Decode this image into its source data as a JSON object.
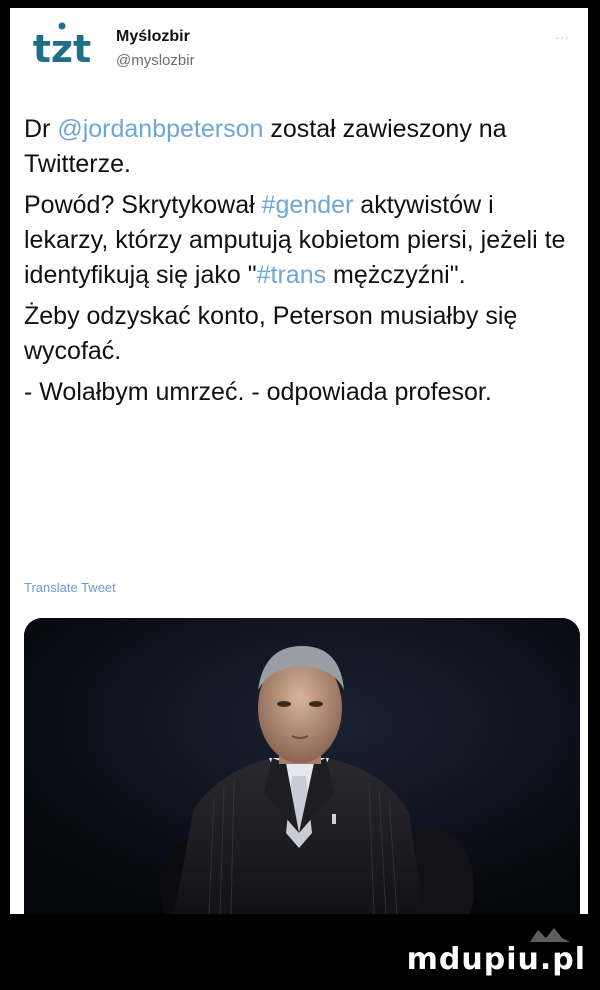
{
  "account": {
    "name": "Myślozbir",
    "handle": "@myslozbir",
    "logo_text": "tzt",
    "logo_color": "#1f6f86"
  },
  "more_menu": "...",
  "tweet": {
    "paragraphs": [
      [
        {
          "text": "Dr ",
          "link": false
        },
        {
          "text": "@jordanbpeterson",
          "link": true
        },
        {
          "text": " został zawieszony na Twitterze.",
          "link": false
        }
      ],
      [
        {
          "text": "Powód? Skrytykował ",
          "link": false
        },
        {
          "text": "#gender",
          "link": true
        },
        {
          "text": " aktywistów i lekarzy, którzy amputują kobietom piersi, jeżeli te identyfikują się jako \"",
          "link": false
        },
        {
          "text": "#trans",
          "link": true
        },
        {
          "text": " mężczyźni\".",
          "link": false
        }
      ],
      [
        {
          "text": "Żeby odzyskać konto, Peterson musiałby się wycofać.",
          "link": false
        }
      ],
      [
        {
          "text": "- Wolałbym umrzeć. - odpowiada profesor.",
          "link": false
        }
      ]
    ]
  },
  "translate_label": "Translate Tweet",
  "media": {
    "icon": "photo-of-man-in-suit"
  },
  "watermark": "mdupiu.pl",
  "colors": {
    "link": "#6fa6d6",
    "background": "#000000",
    "card": "#ffffff"
  }
}
